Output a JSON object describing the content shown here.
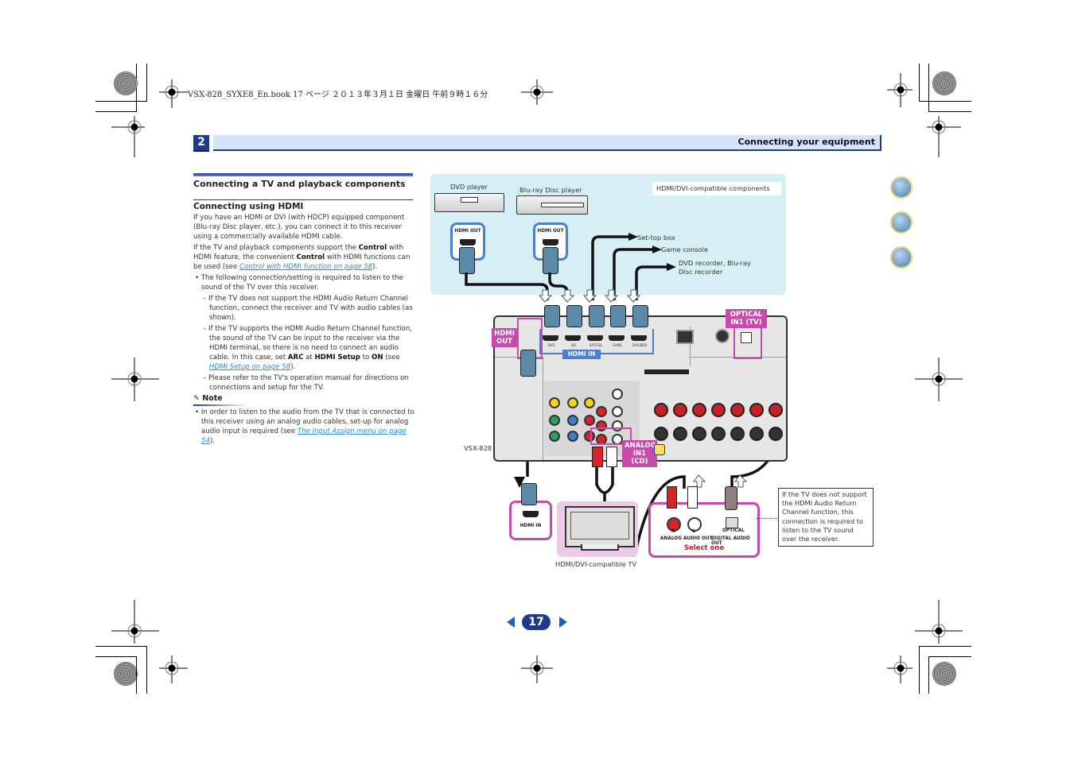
{
  "print_header": "VSX-828_SYXE8_En.book   17 ページ   ２０１３年３月１日   金曜日   午前９時１６分",
  "header": {
    "chapter_number": "2",
    "section_title": "Connecting your equipment"
  },
  "section": {
    "title": "Connecting a TV and playback components",
    "subtitle": "Connecting using HDMI"
  },
  "body": {
    "p1": "If you have an HDMI or DVI (with HDCP) equipped component (Blu-ray Disc player, etc.), you can connect it to this receiver using a commercially available HDMI cable.",
    "p2_a": "If the TV and playback components support the ",
    "p2_b1": "Control",
    "p2_c": " with HDMI feature, the convenient ",
    "p2_b2": "Control",
    "p2_d": " with HDMI functions can be used (see ",
    "p2_link": "Control with HDMI function on page 58",
    "p2_e": ").",
    "bullet1": "The following connection/setting is required to listen to the sound of the TV over this receiver.",
    "dash1": "If the TV does not support the HDMI Audio Return Channel function, connect the receiver and TV with audio cables (as shown).",
    "dash2_a": "If the TV supports the HDMI Audio Return Channel function, the sound of the TV can be input to the receiver via the HDMI terminal, so there is no need to connect an audio cable. In this case, set ",
    "dash2_arc": "ARC",
    "dash2_at": " at ",
    "dash2_setup": "HDMI Setup",
    "dash2_to": " to ",
    "dash2_on": "ON",
    "dash2_see": " (see ",
    "dash2_link": "HDMI Setup on page 58",
    "dash2_end": ").",
    "dash3": "Please refer to the TV's operation manual for directions on connections and setup for the TV."
  },
  "note": {
    "heading": "Note",
    "text_a": "In order to listen to the audio from the TV that is connected to this receiver using an analog audio cables, set-up for analog audio input is required (see ",
    "link": "The Input Assign menu on page 54",
    "text_b": ")."
  },
  "diagram": {
    "dvd_player": "DVD player",
    "bluray_player": "Blu-ray Disc player",
    "compatible_components": "HDMI/DVI-compatible components",
    "hdmi_out": "HDMI OUT",
    "set_top_box": "Set-top box",
    "game_console": "Game console",
    "dvd_recorder": "DVD recorder, Blu-ray",
    "dvd_recorder2": "Disc recorder",
    "receiver_model": "VSX-828",
    "tag_hdmi_out": "HDMI OUT",
    "tag_hdmi_in": "HDMI IN",
    "tag_optical": "OPTICAL IN1 (TV)",
    "tag_analog": "ANALOG IN1 (CD)",
    "hdmi_inputs": [
      "DVD",
      "BD",
      "SAT/CBL",
      "GAME",
      "DVR/BDR"
    ],
    "tv_hdmi_in": "HDMI IN",
    "tv_r": "R",
    "tv_l": "L",
    "analog_audio_out": "ANALOG AUDIO OUT",
    "optical": "OPTICAL",
    "digital_audio_out": "DIGITAL AUDIO OUT",
    "select_one": "Select one",
    "tv_label": "HDMI/DVI-compatible TV",
    "info_text": "If the TV does not support the HDMI Audio Return Channel function, this connection is required to listen to the TV sound over the receiver."
  },
  "side_nav": [
    {
      "icon": "book-icon"
    },
    {
      "icon": "components-icon"
    },
    {
      "icon": "faq-icon"
    }
  ],
  "pagination": {
    "page": "17",
    "prev_icon": "prev-page-icon",
    "next_icon": "next-page-icon"
  },
  "colors": {
    "brand_blue": "#1f3a8a",
    "header_bg": "#d6e4fb",
    "diagram_bg": "#d6eff5",
    "tag_magenta": "#c64bab",
    "hdmi_in_blue": "#4a7fd0",
    "select_red": "#e8101a"
  }
}
